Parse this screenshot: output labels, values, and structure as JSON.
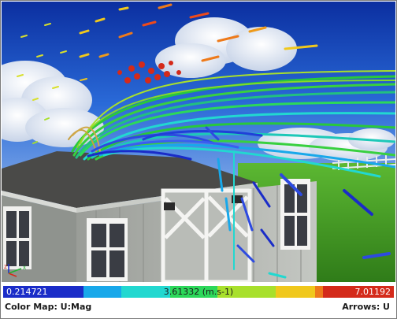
{
  "colorbar": {
    "min": "0.214721",
    "mid": "3.61332 (m.s-1)",
    "max": "7.01192",
    "colors": [
      "#1a2cc8",
      "#18a8ea",
      "#22d8d0",
      "#2cd85a",
      "#a8e02c",
      "#f0c81c",
      "#ee7a1a",
      "#d42a1a"
    ]
  },
  "status": {
    "colormap": "Color Map: U:Mag",
    "arrows": "Arrows: U"
  },
  "axes": {
    "x": "x",
    "z": "z"
  }
}
